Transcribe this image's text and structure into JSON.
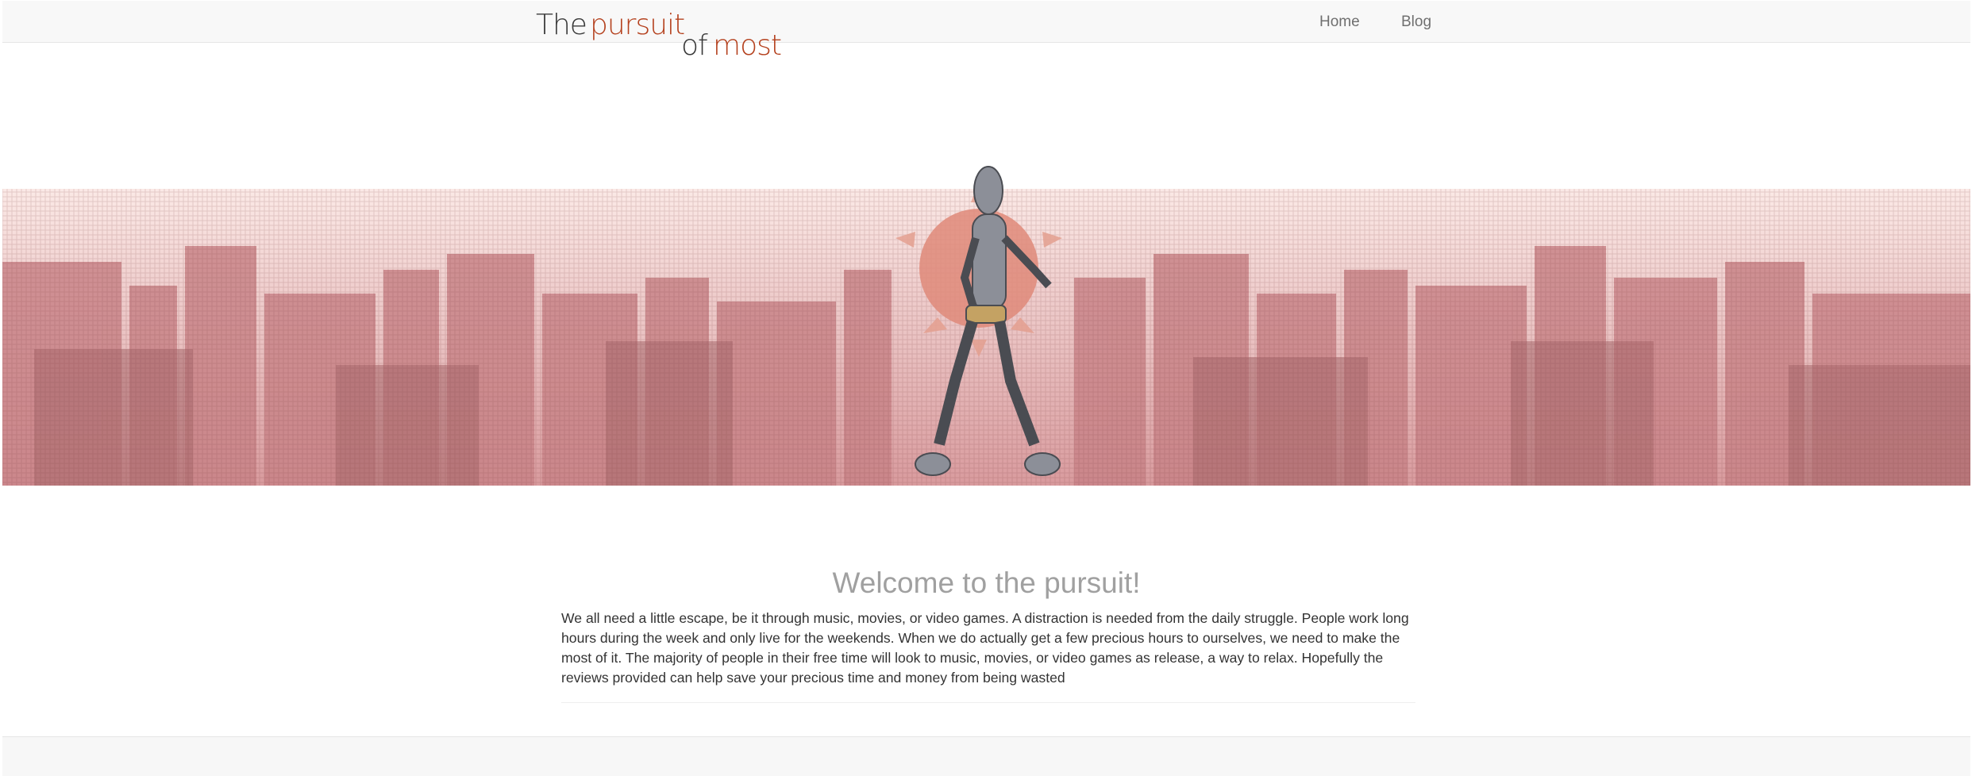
{
  "brand": {
    "the": "The",
    "pursuit": "pursuit",
    "of": "of",
    "most": "most"
  },
  "nav": {
    "home": "Home",
    "blog": "Blog"
  },
  "hero": {
    "image": "robot-city-banner"
  },
  "welcome": {
    "title": "Welcome to the pursuit!",
    "text": "We all need a little escape, be it through music, movies, or video games. A distraction is needed from the daily struggle. People work long hours during the week and only live for the weekends. When we do actually get a few precious hours to ourselves, we need to make the most of it. The majority of people in their free time will look to music, movies, or video games as release, a way to relax. Hopefully the reviews provided can help save your precious time and money from being wasted"
  },
  "colors": {
    "accent": "#b5421f",
    "navbar": "#f8f8f8",
    "heading": "#a0a0a0",
    "body_text": "#333333"
  }
}
